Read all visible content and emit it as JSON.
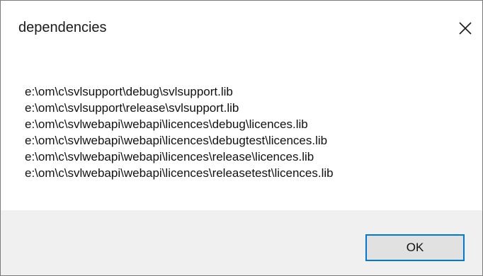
{
  "dialog": {
    "title": "dependencies",
    "close_icon": "close-icon",
    "lines": [
      "e:\\om\\c\\svlsupport\\debug\\svlsupport.lib",
      "e:\\om\\c\\svlsupport\\release\\svlsupport.lib",
      "e:\\om\\c\\svlwebapi\\webapi\\licences\\debug\\licences.lib",
      "e:\\om\\c\\svlwebapi\\webapi\\licences\\debugtest\\licences.lib",
      "e:\\om\\c\\svlwebapi\\webapi\\licences\\release\\licences.lib",
      "e:\\om\\c\\svlwebapi\\webapi\\licences\\releasetest\\licences.lib"
    ],
    "ok_label": "OK"
  },
  "colors": {
    "accent": "#0078d7",
    "footer_bg": "#f0f0f0",
    "button_bg": "#e1e1e1"
  }
}
